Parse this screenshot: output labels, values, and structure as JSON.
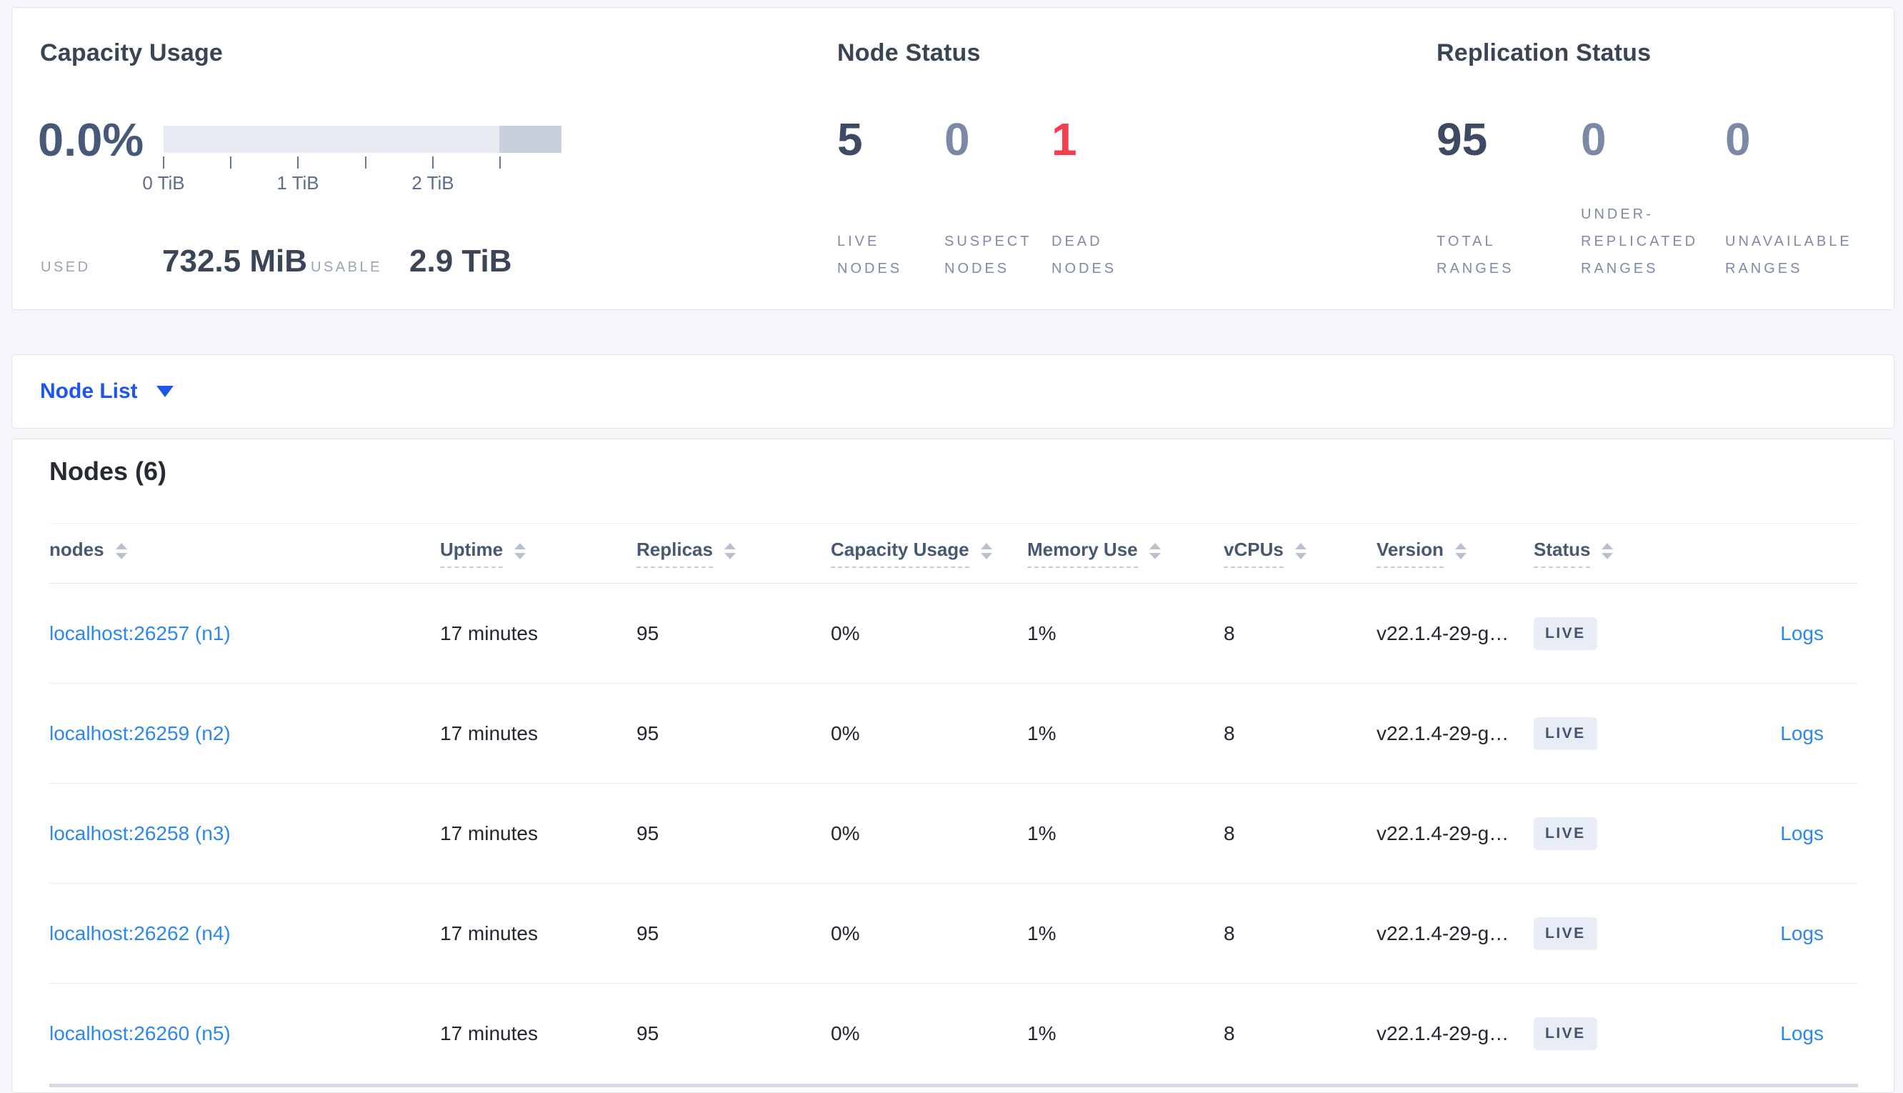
{
  "colors": {
    "page_bg": "#f4f6f9",
    "accent_blue": "#1d55ef",
    "link_blue": "#2d87f0",
    "dark_slate": "#47597a",
    "muted_slate": "#7c89a6",
    "dead_red": "#f43d51",
    "badge_bg": "#e8ecf4",
    "bar_track": "#e8eaf1",
    "bar_end_segment": "#c9cfdc"
  },
  "capacity_card": {
    "title": "Capacity Usage",
    "percent_used": "0.0%",
    "axis_ticks": [
      "0 TiB",
      "1 TiB",
      "2 TiB"
    ],
    "axis_max_tib": 2.9,
    "tick_interval_tib": 0.5,
    "used_label": "USED",
    "used_value": "732.5 MiB",
    "usable_label": "USABLE",
    "usable_value": "2.9 TiB"
  },
  "node_status_card": {
    "title": "Node Status",
    "stats": [
      {
        "value": "5",
        "label": "LIVE NODES"
      },
      {
        "value": "0",
        "label": "SUSPECT NODES"
      },
      {
        "value": "1",
        "label": "DEAD NODES"
      }
    ]
  },
  "replication_card": {
    "title": "Replication Status",
    "stats": [
      {
        "value": "95",
        "label": "TOTAL RANGES"
      },
      {
        "value": "0",
        "label": "UNDER-REPLICATED RANGES"
      },
      {
        "value": "0",
        "label": "UNAVAILABLE RANGES"
      }
    ]
  },
  "view_selector": {
    "label": "Node List"
  },
  "nodes_table": {
    "heading": "Nodes (6)",
    "columns": [
      "nodes",
      "Uptime",
      "Replicas",
      "Capacity Usage",
      "Memory Use",
      "vCPUs",
      "Version",
      "Status"
    ],
    "rows": [
      {
        "address": "localhost:26257 (n1)",
        "uptime": "17 minutes",
        "replicas": "95",
        "capacity": "0%",
        "memory": "1%",
        "vcpus": "8",
        "version": "v22.1.4-29-g…",
        "status": "LIVE",
        "logs": "Logs"
      },
      {
        "address": "localhost:26259 (n2)",
        "uptime": "17 minutes",
        "replicas": "95",
        "capacity": "0%",
        "memory": "1%",
        "vcpus": "8",
        "version": "v22.1.4-29-g…",
        "status": "LIVE",
        "logs": "Logs"
      },
      {
        "address": "localhost:26258 (n3)",
        "uptime": "17 minutes",
        "replicas": "95",
        "capacity": "0%",
        "memory": "1%",
        "vcpus": "8",
        "version": "v22.1.4-29-g…",
        "status": "LIVE",
        "logs": "Logs"
      },
      {
        "address": "localhost:26262 (n4)",
        "uptime": "17 minutes",
        "replicas": "95",
        "capacity": "0%",
        "memory": "1%",
        "vcpus": "8",
        "version": "v22.1.4-29-g…",
        "status": "LIVE",
        "logs": "Logs"
      },
      {
        "address": "localhost:26260 (n5)",
        "uptime": "17 minutes",
        "replicas": "95",
        "capacity": "0%",
        "memory": "1%",
        "vcpus": "8",
        "version": "v22.1.4-29-g…",
        "status": "LIVE",
        "logs": "Logs"
      }
    ]
  }
}
